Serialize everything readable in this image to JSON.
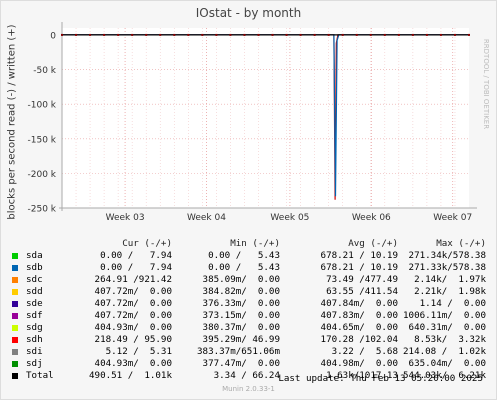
{
  "chart_data": {
    "type": "line",
    "title": "IOstat - by month",
    "ylabel": "blocks per second read (-) / written (+)",
    "side_label": "RRDTOOL / TOBI OETIKER",
    "ylim": [
      -250000,
      10000
    ],
    "y_ticks": [
      {
        "value": 0,
        "label": "0"
      },
      {
        "value": -50000,
        "label": "-50 k"
      },
      {
        "value": -100000,
        "label": "-100 k"
      },
      {
        "value": -150000,
        "label": "-150 k"
      },
      {
        "value": -200000,
        "label": "-200 k"
      },
      {
        "value": -250000,
        "label": "-250 k"
      }
    ],
    "x_ticks": [
      "Week 03",
      "Week 04",
      "Week 05",
      "Week 06",
      "Week 07"
    ],
    "grid": true,
    "series": [
      {
        "name": "sdh",
        "color": "#cc0000",
        "points": [
          [
            0,
            0
          ],
          [
            0.668,
            0
          ],
          [
            0.671,
            -238000
          ],
          [
            0.674,
            -12000
          ],
          [
            0.678,
            0
          ],
          [
            1,
            0
          ]
        ]
      },
      {
        "name": "sdb",
        "color": "#0066b3",
        "points": [
          [
            0,
            0
          ],
          [
            0.668,
            0
          ],
          [
            0.672,
            -233000
          ],
          [
            0.676,
            -8000
          ],
          [
            0.68,
            0
          ],
          [
            1,
            0
          ]
        ]
      },
      {
        "name": "Total",
        "color": "#000000",
        "points": [
          [
            0,
            0
          ],
          [
            1,
            0
          ]
        ]
      }
    ]
  },
  "legend": {
    "columns": {
      "cur": "Cur (-/+)",
      "min": "Min (-/+)",
      "avg": "Avg (-/+)",
      "max": "Max (-/+)"
    },
    "rows": [
      {
        "name": "sda",
        "color": "#00cc00",
        "cur": "0.00 /   7.94",
        "min": "0.00 /   5.43",
        "avg": "678.21 / 10.19",
        "max": "271.34k/578.38"
      },
      {
        "name": "sdb",
        "color": "#0066b3",
        "cur": "0.00 /   7.94",
        "min": "0.00 /   5.43",
        "avg": "678.21 / 10.19",
        "max": "271.33k/578.38"
      },
      {
        "name": "sdc",
        "color": "#ff8000",
        "cur": "264.91 /921.42",
        "min": "385.09m/  0.00",
        "avg": "73.49 /477.49",
        "max": "2.14k/  1.97k"
      },
      {
        "name": "sdd",
        "color": "#ffcc00",
        "cur": "407.72m/  0.00",
        "min": "384.82m/  0.00",
        "avg": "63.55 /411.54",
        "max": "2.21k/  1.98k"
      },
      {
        "name": "sde",
        "color": "#330099",
        "cur": "407.72m/  0.00",
        "min": "376.33m/  0.00",
        "avg": "407.84m/  0.00",
        "max": "1.14 /  0.00"
      },
      {
        "name": "sdf",
        "color": "#990099",
        "cur": "407.72m/  0.00",
        "min": "373.15m/  0.00",
        "avg": "407.83m/  0.00",
        "max": "1006.11m/  0.00"
      },
      {
        "name": "sdg",
        "color": "#ccff00",
        "cur": "404.93m/  0.00",
        "min": "380.37m/  0.00",
        "avg": "404.65m/  0.00",
        "max": "640.31m/  0.00"
      },
      {
        "name": "sdh",
        "color": "#ff0000",
        "cur": "218.49 / 95.90",
        "min": "395.29m/ 46.99",
        "avg": "170.28 /102.04",
        "max": "8.53k/  3.32k"
      },
      {
        "name": "sdi",
        "color": "#808080",
        "cur": "5.12 /  5.31",
        "min": "383.37m/651.06m",
        "avg": "3.22 /  5.68",
        "max": "214.08 /  1.02k"
      },
      {
        "name": "sdj",
        "color": "#008f00",
        "cur": "404.93m/  0.00",
        "min": "377.47m/  0.00",
        "avg": "404.98m/  0.00",
        "max": "635.04m/  0.00"
      },
      {
        "name": "Total",
        "color": "#000000",
        "cur": "490.51 /  1.01k",
        "min": "3.34 / 66.24",
        "avg": "1.63k/1017.13",
        "max": "544.03k/  6.21k"
      }
    ]
  },
  "last_update": "Last update:  Thu Feb 13 05:20:00 2025",
  "footer": "Munin 2.0.33-1"
}
